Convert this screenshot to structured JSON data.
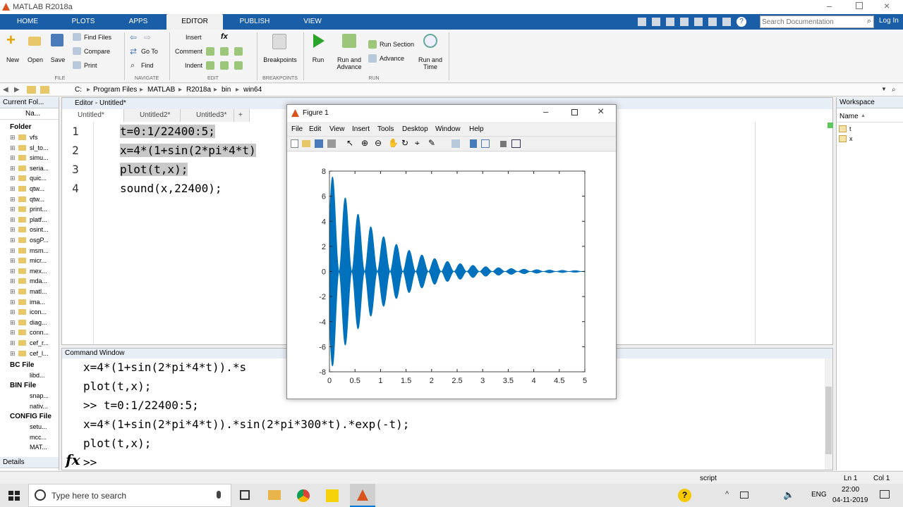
{
  "window": {
    "title": "MATLAB R2018a"
  },
  "tabs": [
    "HOME",
    "PLOTS",
    "APPS",
    "EDITOR",
    "PUBLISH",
    "VIEW"
  ],
  "search": {
    "placeholder": "Search Documentation",
    "login": "Log In"
  },
  "ribbon": {
    "file": {
      "new": "New",
      "open": "Open",
      "save": "Save",
      "find_files": "Find Files",
      "compare": "Compare",
      "print": "Print",
      "group": "FILE"
    },
    "navigate": {
      "go_to": "Go To",
      "find": "Find",
      "group": "NAVIGATE"
    },
    "edit": {
      "insert": "Insert",
      "comment": "Comment",
      "indent": "Indent",
      "fx": "fx",
      "group": "EDIT"
    },
    "breakpoints": {
      "label": "Breakpoints",
      "group": "BREAKPOINTS"
    },
    "run": {
      "run": "Run",
      "run_advance": "Run and\nAdvance",
      "run_section": "Run Section",
      "advance": "Advance",
      "run_time": "Run and\nTime",
      "group": "RUN"
    }
  },
  "path": [
    "C:",
    "Program Files",
    "MATLAB",
    "R2018a",
    "bin",
    "win64"
  ],
  "current_folder": {
    "title": "Current Fol...",
    "col": "Na...",
    "folder_header": "Folder",
    "items": [
      "vfs",
      "sl_to...",
      "simu...",
      "seria...",
      "quic...",
      "qtw...",
      "qtw...",
      "print...",
      "platf...",
      "osint...",
      "osgP...",
      "msm...",
      "micr...",
      "mex...",
      "mda...",
      "matl...",
      "ima...",
      "icon...",
      "diag...",
      "conn...",
      "cef_r...",
      "cef_l..."
    ],
    "bc_header": "BC File",
    "bc_items": [
      "libd..."
    ],
    "bin_header": "BIN File",
    "bin_items": [
      "snap...",
      "nativ..."
    ],
    "config_header": "CONFIG File",
    "config_items": [
      "setu...",
      "mcc...",
      "MAT..."
    ],
    "details": "Details"
  },
  "editor": {
    "title": "Editor - Untitled*",
    "tabs": [
      "Untitled*",
      "Untitled2*",
      "Untitled3*"
    ],
    "add": "+",
    "lines": [
      {
        "n": "1",
        "code": "t=0:1/22400:5;"
      },
      {
        "n": "2",
        "code": "x=4*(1+sin(2*pi*4*t)"
      },
      {
        "n": "3",
        "code": "plot(t,x);"
      },
      {
        "n": "4",
        "code": "sound(x,22400);"
      }
    ]
  },
  "command": {
    "title": "Command Window",
    "lines": [
      "x=4*(1+sin(2*pi*4*t)).*s",
      "plot(t,x);",
      ">> t=0:1/22400:5;",
      "x=4*(1+sin(2*pi*4*t)).*sin(2*pi*300*t).*exp(-t);",
      "plot(t,x);"
    ],
    "fx": "fx",
    "prompt": ">>"
  },
  "workspace": {
    "title": "Workspace",
    "col": "Name",
    "sort": "▲",
    "vars": [
      "t",
      "x"
    ]
  },
  "status": {
    "mode": "script",
    "ln": "Ln 1",
    "col": "Col 1"
  },
  "taskbar": {
    "search": "Type here to search",
    "lang": "ENG",
    "time": "22:00",
    "date": "04-11-2019"
  },
  "figure": {
    "title": "Figure 1",
    "menu": [
      "File",
      "Edit",
      "View",
      "Insert",
      "Tools",
      "Desktop",
      "Window",
      "Help"
    ]
  },
  "chart_data": {
    "type": "line",
    "series": [
      {
        "x_range": [
          0,
          5
        ],
        "formula": "x=4*(1+sin(2*pi*4*t)).*sin(2*pi*300*t).*exp(-t)"
      }
    ],
    "xlim": [
      0,
      5
    ],
    "ylim": [
      -8,
      8
    ],
    "xticks": [
      "0",
      "0.5",
      "1",
      "1.5",
      "2",
      "2.5",
      "3",
      "3.5",
      "4",
      "4.5",
      "5"
    ],
    "yticks": [
      "8",
      "6",
      "4",
      "2",
      "0",
      "-2",
      "-4",
      "-6",
      "-8"
    ],
    "color": "#0072bd"
  },
  "colors": {
    "accent": "#1b5ea8",
    "plot": "#0072bd"
  }
}
